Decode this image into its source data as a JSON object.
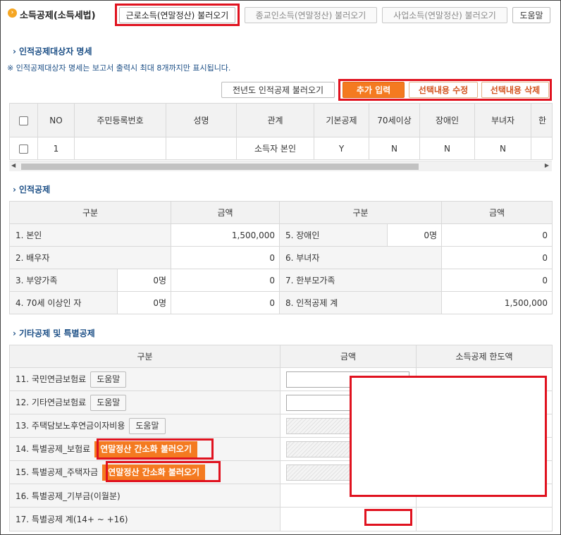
{
  "header": {
    "title": "소득공제(소득세법)",
    "buttons": [
      "근로소득(연말정산) 불러오기",
      "종교인소득(연말정산) 불러오기",
      "사업소득(연말정산) 불러오기",
      "도움말"
    ]
  },
  "dependents": {
    "title": "인적공제대상자 명세",
    "note": "※ 인적공제대상자 명세는 보고서 출력시 최대 8개까지만 표시됩니다.",
    "buttons": {
      "prev_year": "전년도 인적공제 불러오기",
      "add": "추가 입력",
      "edit": "선택내용 수정",
      "delete": "선택내용 삭제"
    },
    "columns": [
      "NO",
      "주민등록번호",
      "성명",
      "관계",
      "기본공제",
      "70세이상",
      "장애인",
      "부녀자",
      "한"
    ],
    "rows": [
      {
        "no": "1",
        "rrn": "",
        "name": "",
        "relation": "소득자 본인",
        "basic": "Y",
        "age70": "N",
        "disabled": "N",
        "woman": "N"
      }
    ]
  },
  "personal": {
    "title": "인적공제",
    "headers": {
      "category": "구분",
      "amount": "금액"
    },
    "left": [
      {
        "label": "1. 본인",
        "count": "",
        "amount": "1,500,000"
      },
      {
        "label": "2. 배우자",
        "count": "",
        "amount": "0"
      },
      {
        "label": "3. 부양가족",
        "count": "0명",
        "amount": "0"
      },
      {
        "label": "4. 70세 이상인 자",
        "count": "0명",
        "amount": "0"
      }
    ],
    "right": [
      {
        "label": "5. 장애인",
        "count": "0명",
        "amount": "0"
      },
      {
        "label": "6. 부녀자",
        "count": "",
        "amount": "0"
      },
      {
        "label": "7. 한부모가족",
        "count": "",
        "amount": "0"
      },
      {
        "label": "8. 인적공제 계",
        "count": "",
        "amount": "1,500,000"
      }
    ]
  },
  "other": {
    "title": "기타공제 및 특별공제",
    "headers": {
      "category": "구분",
      "amount": "금액",
      "limit": "소득공제 한도액"
    },
    "rows": [
      {
        "label": "11. 국민연금보험료",
        "btn": "도움말"
      },
      {
        "label": "12. 기타연금보험료",
        "btn": "도움말"
      },
      {
        "label": "13. 주택담보노후연금이자비용",
        "btn": "도움말"
      },
      {
        "label": "14. 특별공제_보험료",
        "btn": "연말정산 간소화 불러오기"
      },
      {
        "label": "15. 특별공제_주택자금",
        "btn": "연말정산 간소화 불러오기"
      },
      {
        "label": "16. 특별공제_기부금(이월분)"
      },
      {
        "label": "17. 특별공제 계(14+ ~ +16)"
      }
    ]
  },
  "colors": {
    "accent": "#f47a20",
    "highlight": "#e0121f",
    "section_title": "#1c4f86"
  }
}
